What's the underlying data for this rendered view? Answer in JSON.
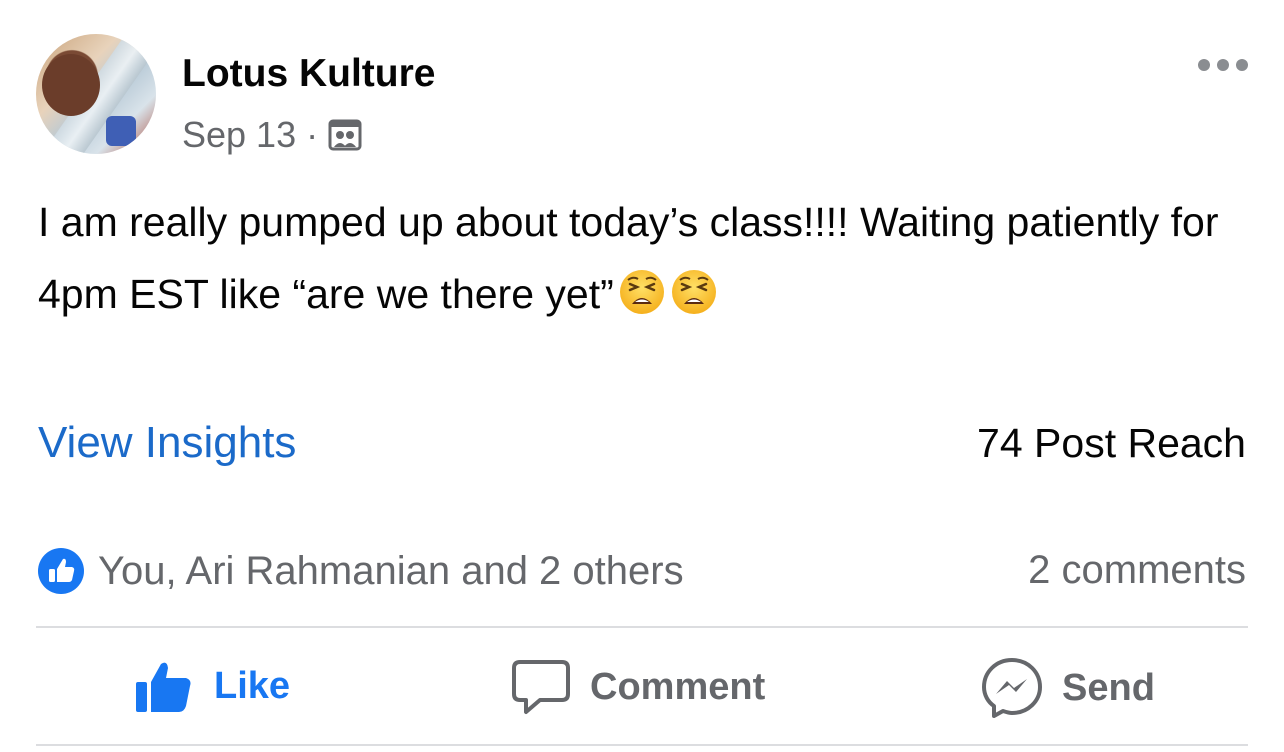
{
  "post": {
    "page_name": "Lotus Kulture",
    "date": "Sep 13",
    "separator": "·",
    "audience_icon": "group-icon",
    "text": "I am really pumped up about today’s class!!!! Waiting patiently for 4pm EST like “are we there yet”",
    "emojis": [
      "weary-face",
      "weary-face"
    ]
  },
  "insights": {
    "view_insights_label": "View Insights",
    "post_reach": "74 Post Reach"
  },
  "engagement": {
    "reactions_text": "You, Ari Rahmanian and 2 others",
    "comments": "2 comments"
  },
  "actions": {
    "like_label": "Like",
    "comment_label": "Comment",
    "send_label": "Send"
  },
  "colors": {
    "accent_blue": "#1877f2",
    "link_blue": "#1b6ac9",
    "secondary_text": "#65676b"
  }
}
